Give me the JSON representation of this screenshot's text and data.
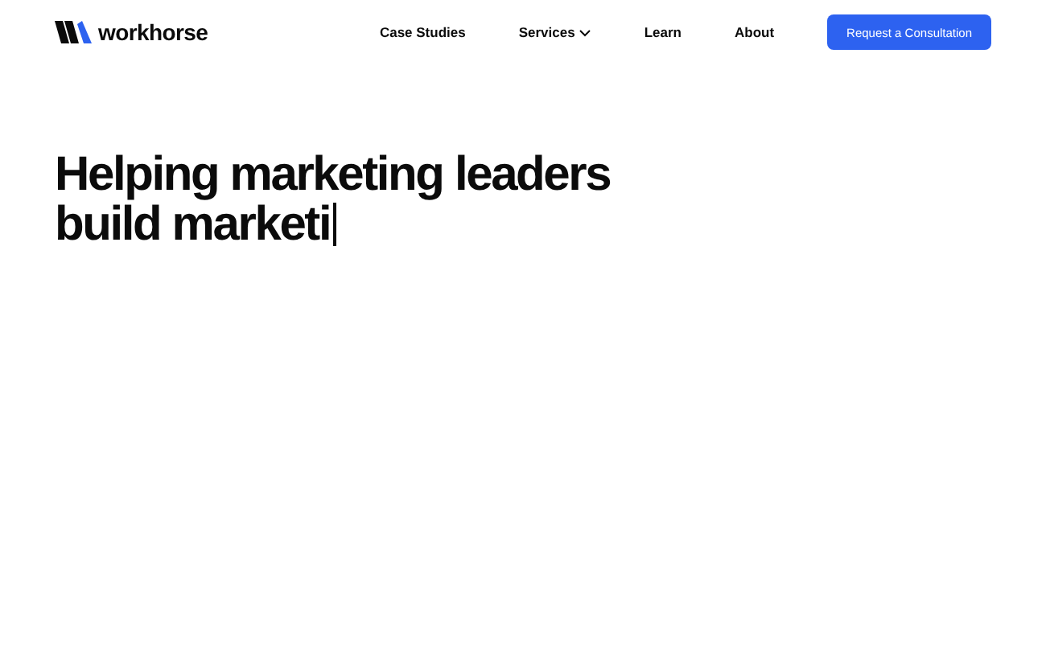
{
  "header": {
    "logo": {
      "text": "workhorse"
    },
    "nav": [
      {
        "label": "Case Studies",
        "has_menu": false
      },
      {
        "label": "Services",
        "has_menu": true
      },
      {
        "label": "Learn",
        "has_menu": false
      },
      {
        "label": "About",
        "has_menu": false
      }
    ],
    "cta": "Request a Consultation"
  },
  "hero": {
    "headline_lines": [
      "Helping marketing leaders",
      "build marketi"
    ],
    "typing_cursor": true
  }
}
